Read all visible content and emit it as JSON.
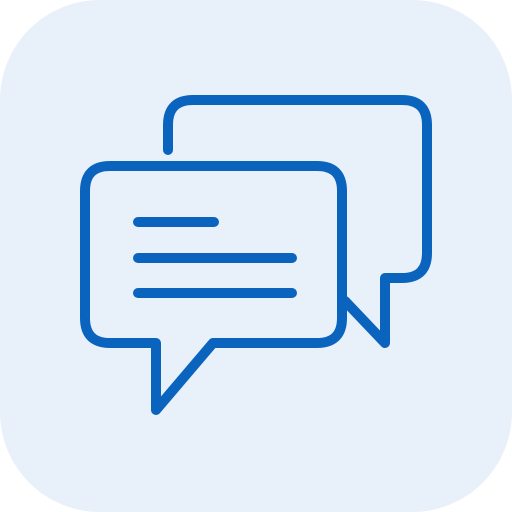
{
  "icon": {
    "name": "chat-bubbles-icon",
    "background_color": "#E8F0FA",
    "stroke_color": "#0A64BE"
  }
}
